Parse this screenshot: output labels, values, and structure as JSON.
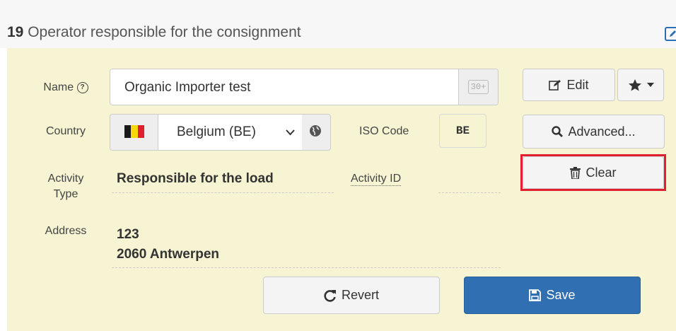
{
  "section": {
    "number": "19",
    "title": "Operator responsible for the consignment"
  },
  "name": {
    "label": "Name",
    "value": "Organic Importer test",
    "addon_badge": "30+"
  },
  "country": {
    "label": "Country",
    "selected": "Belgium (BE)",
    "flag_colors": [
      "#1a1a1a",
      "#f5d90a",
      "#e0202e"
    ]
  },
  "iso": {
    "label": "ISO Code",
    "value": "BE"
  },
  "activity_type": {
    "label_line1": "Activity",
    "label_line2": "Type",
    "value": "Responsible for the load"
  },
  "activity_id": {
    "label": "Activity ID",
    "value": ""
  },
  "address": {
    "label": "Address",
    "line1": "123",
    "line2": "2060 Antwerpen"
  },
  "buttons": {
    "edit": "Edit",
    "advanced": "Advanced...",
    "clear": "Clear",
    "revert": "Revert",
    "save": "Save"
  },
  "colors": {
    "panel_bg": "#f6f4d2",
    "primary": "#2f6fb2",
    "highlight": "#e0202e"
  }
}
